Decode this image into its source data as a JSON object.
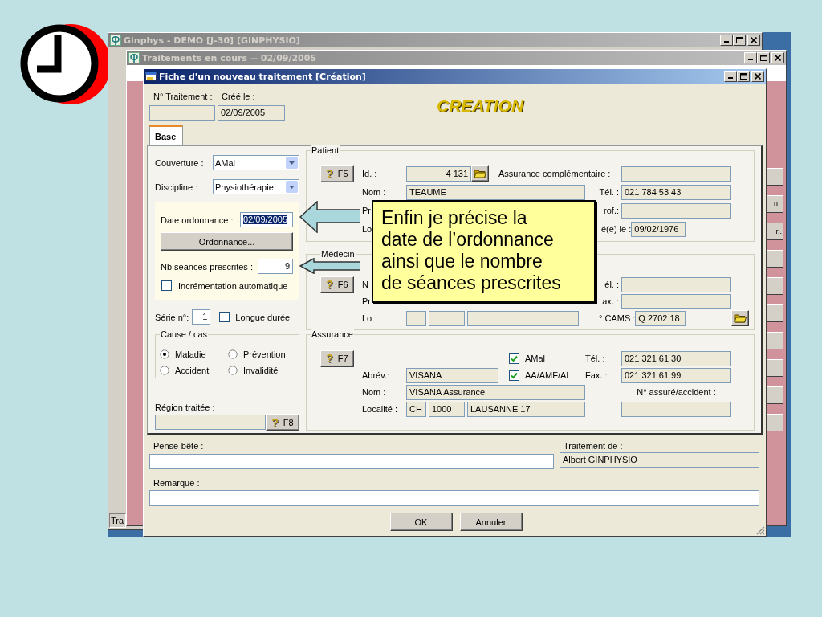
{
  "windows": [
    {
      "title": "Ginphys - DEMO [J-30] [GINPHYSIO]",
      "status_text": "Tra"
    },
    {
      "title": "Traitements en cours  -- 02/09/2005",
      "side_button_labels": [
        "u..",
        "r.."
      ]
    }
  ],
  "dialog": {
    "title": "Fiche d'un nouveau traitement [Création]",
    "mode_banner": "CREATION",
    "header": {
      "number_label": "N° Traitement :",
      "created_label": "Créé le :",
      "created_value": "02/09/2005"
    },
    "tabs": [
      {
        "label": "Base",
        "selected": true
      }
    ],
    "left": {
      "couverture": {
        "label": "Couverture :",
        "value": "AMal"
      },
      "discipline": {
        "label": "Discipline :",
        "value": "Physiothérapie"
      },
      "date_ordonnance": {
        "label": "Date ordonnance :",
        "value": "02/09/2005",
        "highlighted": true
      },
      "ordonnance_button": "Ordonnance...",
      "nb_seances": {
        "label": "Nb séances prescrites :",
        "value": "9"
      },
      "auto_increment": {
        "label": "Incrémentation automatique",
        "checked": false
      },
      "serie": {
        "label": "Série n°:",
        "value": "1"
      },
      "longue_duree": {
        "label": "Longue durée",
        "checked": false
      },
      "cause": {
        "title": "Cause / cas",
        "options": [
          {
            "label": "Maladie",
            "selected": true
          },
          {
            "label": "Prévention",
            "selected": false
          },
          {
            "label": "Accident",
            "selected": false
          },
          {
            "label": "Invalidité",
            "selected": false
          }
        ]
      },
      "region": {
        "label": "Région traitée :",
        "lookup": {
          "icon": "?",
          "key": "F8"
        }
      }
    },
    "patient": {
      "title": "Patient",
      "lookup": {
        "icon": "?",
        "key": "F5"
      },
      "fields": [
        {
          "label": "Id. :",
          "value": "4 131"
        },
        {
          "label": "Assurance complémentaire :"
        },
        {
          "label": "Nom :",
          "value": "TEAUME"
        },
        {
          "label": "Tél. :",
          "value": "021 784 53 43"
        },
        {
          "label": "Pr"
        },
        {
          "label": "rof.:"
        },
        {
          "label": "Lo"
        },
        {
          "label": "é(e) le :",
          "value": "09/02/1976"
        }
      ]
    },
    "medecin": {
      "title": "Médecin",
      "lookup": {
        "icon": "?",
        "key": "F6"
      },
      "fields": [
        {
          "label": "N"
        },
        {
          "label": "él. :"
        },
        {
          "label": "Pr"
        },
        {
          "label": "ax. :"
        },
        {
          "label": "Lo"
        },
        {
          "label": "° CAMS :",
          "value": "Q 2702 18"
        }
      ]
    },
    "assurance": {
      "title": "Assurance",
      "lookup": {
        "icon": "?",
        "key": "F7"
      },
      "checks": [
        {
          "label": "AMal",
          "checked": true
        },
        {
          "label": "AA/AMF/AI",
          "checked": true
        }
      ],
      "fields": [
        {
          "label": "Tél. :",
          "value": "021 321 61 30"
        },
        {
          "label": "Abrév.:",
          "value": "VISANA"
        },
        {
          "label": "Fax. :",
          "value": "021 321 61 99"
        },
        {
          "label": "Nom :",
          "value": "VISANA Assurance"
        },
        {
          "label": "N° assuré/accident :"
        },
        {
          "label": "Localité :",
          "values": [
            "CH",
            "1000",
            "LAUSANNE 17"
          ]
        }
      ]
    },
    "bottom": {
      "pense_bete": {
        "label": "Pense-bête :"
      },
      "traitement_de": {
        "label": "Traitement de :",
        "value": "Albert GINPHYSIO"
      },
      "remarque": {
        "label": "Remarque :"
      }
    },
    "buttons": [
      "OK",
      "Annuler"
    ]
  },
  "callout": {
    "lines": [
      "Enfin je précise la",
      "date de l’ordonnance",
      "ainsi que le nombre",
      "de séances prescrites"
    ]
  }
}
